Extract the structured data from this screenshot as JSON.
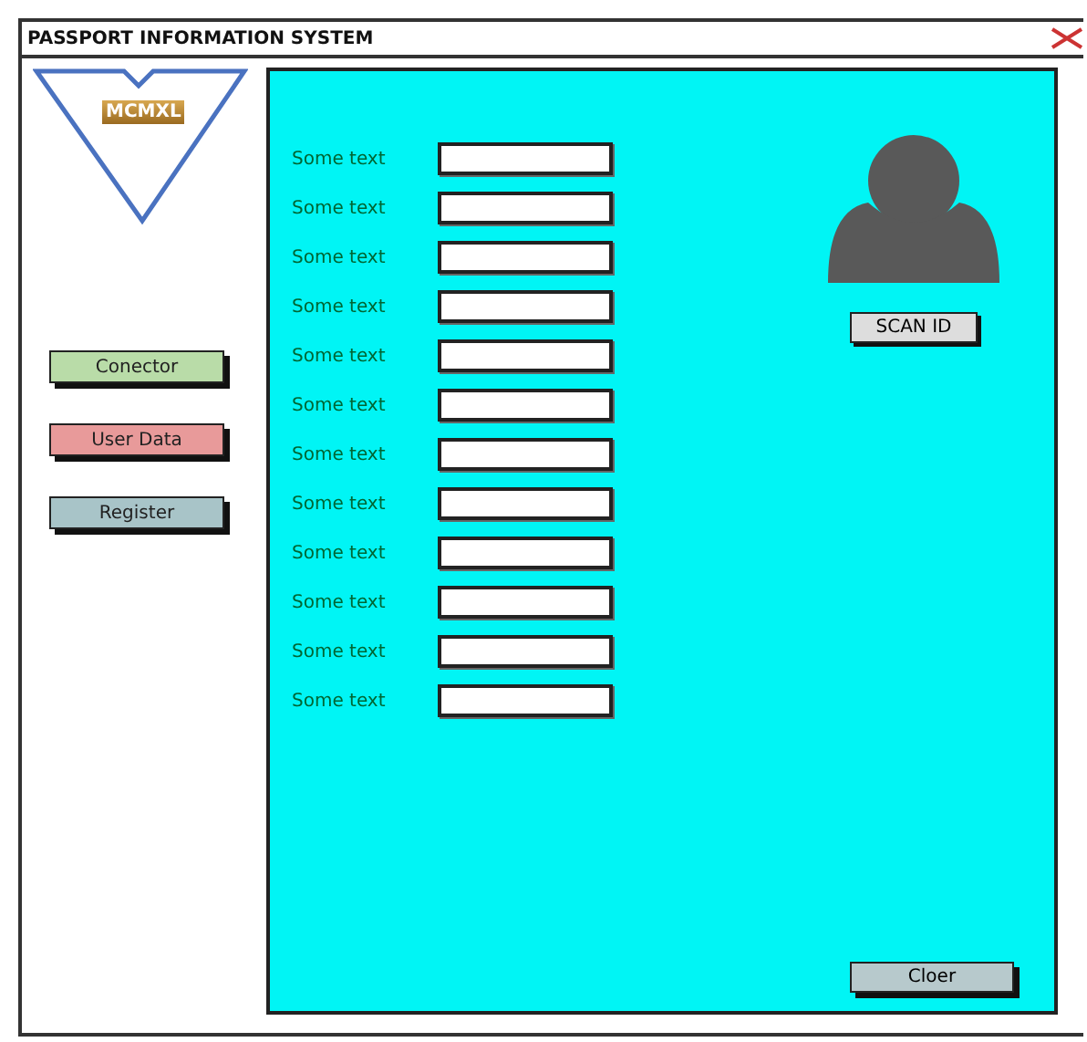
{
  "window": {
    "title": "PASSPORT INFORMATION SYSTEM"
  },
  "logo": {
    "text": "MCMXL"
  },
  "nav_buttons": [
    {
      "label": "Conector",
      "color": "#b9dca8"
    },
    {
      "label": "User Data",
      "color": "#e89a9a"
    },
    {
      "label": "Register",
      "color": "#a8c4c8"
    }
  ],
  "form": {
    "fields": [
      {
        "label": "Some text"
      },
      {
        "label": "Some text"
      },
      {
        "label": "Some text"
      },
      {
        "label": "Some text"
      },
      {
        "label": "Some text"
      },
      {
        "label": "Some text"
      },
      {
        "label": "Some text"
      },
      {
        "label": "Some text"
      },
      {
        "label": "Some text"
      },
      {
        "label": "Some text"
      },
      {
        "label": "Some text"
      },
      {
        "label": "Some text"
      }
    ]
  },
  "scan_button": "SCAN ID",
  "clear_button": "Cloer"
}
